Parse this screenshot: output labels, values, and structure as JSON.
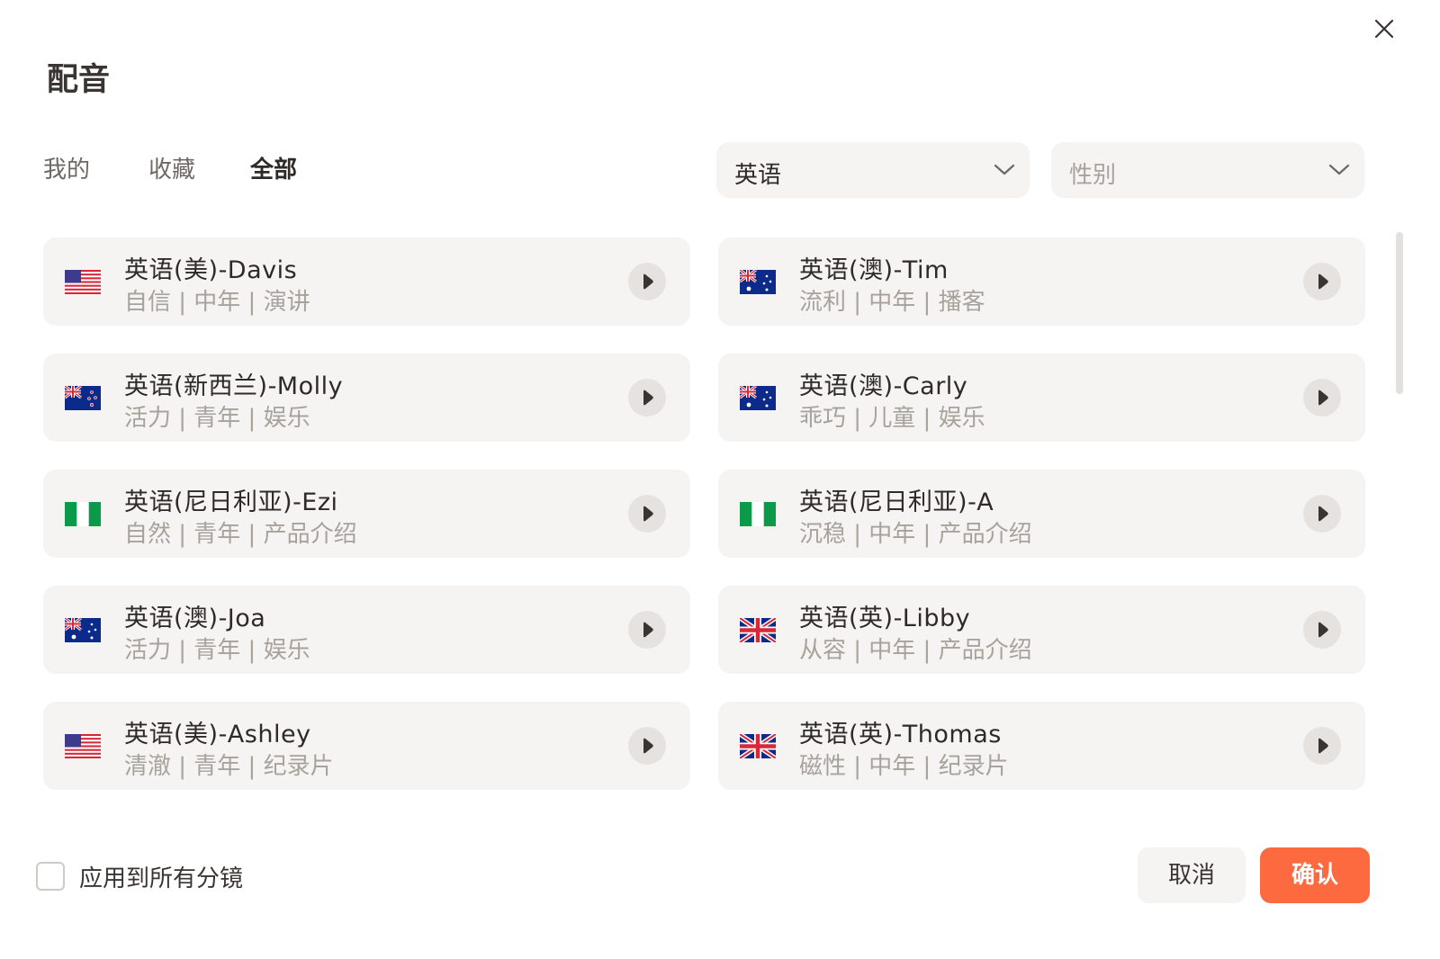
{
  "dialog": {
    "title": "配音",
    "close_icon": "close-icon"
  },
  "tabs": [
    {
      "label": "我的",
      "active": false
    },
    {
      "label": "收藏",
      "active": false
    },
    {
      "label": "全部",
      "active": true
    }
  ],
  "filters": {
    "language": {
      "value": "英语",
      "icon": "chevron-down-icon"
    },
    "gender": {
      "placeholder": "性别",
      "icon": "chevron-down-icon"
    }
  },
  "voices": [
    {
      "name": "英语(美)-Davis",
      "tags": "自信 | 中年 | 演讲",
      "flag": "us-flag-icon"
    },
    {
      "name": "英语(澳)-Tim",
      "tags": "流利 | 中年 | 播客",
      "flag": "au-flag-icon"
    },
    {
      "name": "英语(新西兰)-Molly",
      "tags": "活力 | 青年 | 娱乐",
      "flag": "nz-flag-icon"
    },
    {
      "name": "英语(澳)-Carly",
      "tags": "乖巧 | 儿童 | 娱乐",
      "flag": "au-flag-icon"
    },
    {
      "name": "英语(尼日利亚)-Ezi",
      "tags": "自然 | 青年 | 产品介绍",
      "flag": "ng-flag-icon"
    },
    {
      "name": "英语(尼日利亚)-A",
      "tags": "沉稳 | 中年 | 产品介绍",
      "flag": "ng-flag-icon"
    },
    {
      "name": "英语(澳)-Joa",
      "tags": "活力 | 青年 | 娱乐",
      "flag": "au-flag-icon"
    },
    {
      "name": "英语(英)-Libby",
      "tags": "从容 | 中年 | 产品介绍",
      "flag": "uk-flag-icon"
    },
    {
      "name": "英语(美)-Ashley",
      "tags": "清澈 | 青年 | 纪录片",
      "flag": "us-flag-icon"
    },
    {
      "name": "英语(英)-Thomas",
      "tags": "磁性 | 中年 | 纪录片",
      "flag": "uk-flag-icon"
    }
  ],
  "footer": {
    "apply_all_label": "应用到所有分镜",
    "apply_all_checked": false,
    "cancel_label": "取消",
    "confirm_label": "确认"
  },
  "colors": {
    "accent": "#fd6a3f",
    "card_bg": "#f6f4f2",
    "text_primary": "#2e2a27",
    "text_secondary": "#a8a29d"
  }
}
